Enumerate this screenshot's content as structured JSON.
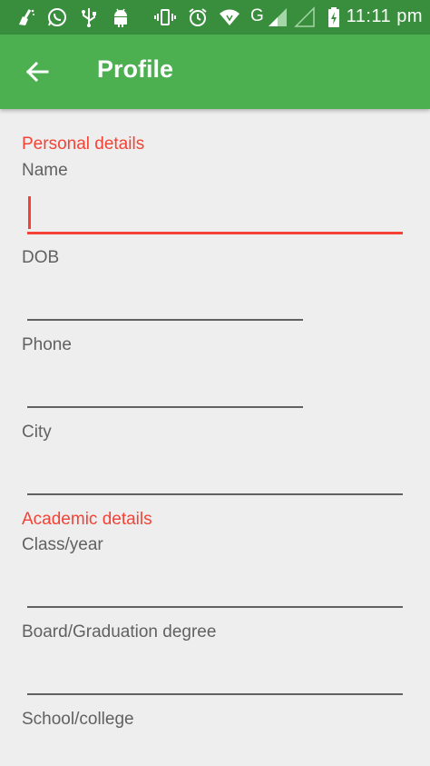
{
  "status_bar": {
    "time": "11:11 pm",
    "network_label": "G",
    "icons": [
      "cleaner-icon",
      "whatsapp-icon",
      "usb-icon",
      "android-icon",
      "vibrate-icon",
      "alarm-icon",
      "wifi-icon",
      "signal-icon",
      "signal-empty-icon",
      "battery-charging-icon"
    ]
  },
  "app_bar": {
    "title": "Profile",
    "back_icon": "arrow-back-icon",
    "color": "#4caf50",
    "status_color": "#388e3c"
  },
  "form": {
    "accent_color": "#f44336",
    "personal_section": "Personal details",
    "name_label": "Name",
    "name_value": "",
    "dob_label": "DOB",
    "dob_value": "",
    "phone_label": "Phone",
    "phone_value": "",
    "city_label": "City",
    "city_value": "",
    "academic_section": "Academic details",
    "class_label": "Class/year",
    "class_value": "",
    "board_label": "Board/Graduation degree",
    "board_value": "",
    "school_label": "School/college",
    "school_value": ""
  }
}
